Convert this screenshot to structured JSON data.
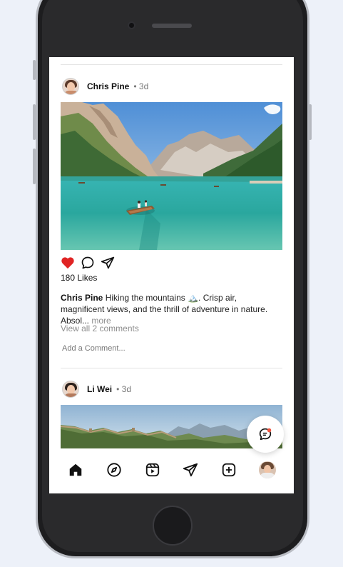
{
  "device": {
    "type": "phone"
  },
  "posts": [
    {
      "username": "Chris Pine",
      "time": "• 3d",
      "likes": "180 Likes",
      "caption_user": "Chris Pine",
      "caption_text": "Hiking the mountains 🏔️. Crisp air, magnificent views, and the thrill of adventure in nature. Absol...",
      "caption_more": "more",
      "view_comments": "View all 2 comments",
      "add_comment": "Add a Comment...",
      "liked": true
    },
    {
      "username": "Li Wei",
      "time": "• 3d"
    }
  ],
  "icons": {
    "like": "heart-icon",
    "comment": "comment-bubble-icon",
    "share": "send-icon",
    "home": "home-icon",
    "explore": "compass-icon",
    "reels": "reels-icon",
    "messages": "send-icon",
    "create": "plus-square-icon",
    "chat_fab": "chat-bubble-icon"
  },
  "colors": {
    "like": "#e02424",
    "notification_dot": "#f0533f"
  }
}
